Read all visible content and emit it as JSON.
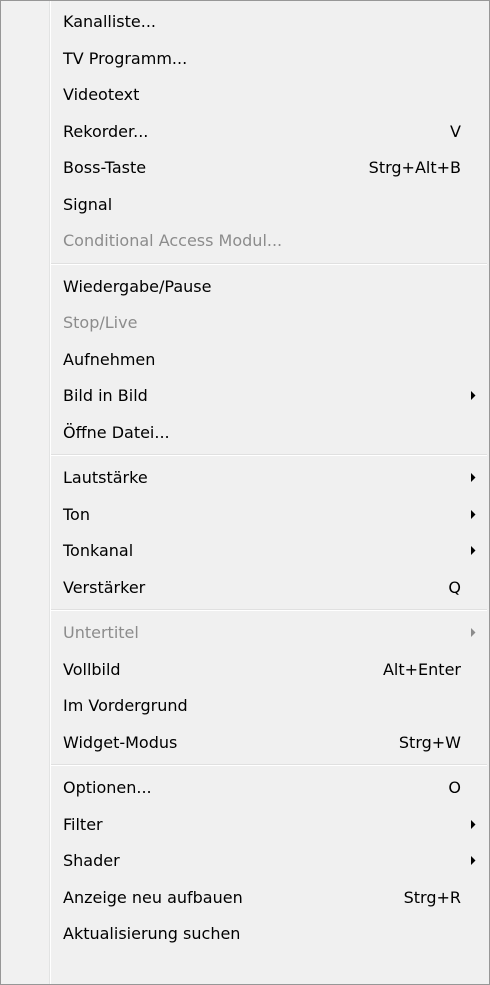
{
  "menu": {
    "groups": [
      {
        "items": [
          {
            "label": "Kanalliste..."
          },
          {
            "label": "TV Programm..."
          },
          {
            "label": "Videotext"
          },
          {
            "label": "Rekorder...",
            "shortcut": "V"
          },
          {
            "label": "Boss-Taste",
            "shortcut": "Strg+Alt+B"
          },
          {
            "label": "Signal"
          },
          {
            "label": "Conditional Access Modul...",
            "disabled": true
          }
        ]
      },
      {
        "items": [
          {
            "label": "Wiedergabe/Pause"
          },
          {
            "label": "Stop/Live",
            "disabled": true
          },
          {
            "label": "Aufnehmen"
          },
          {
            "label": "Bild in Bild",
            "submenu": true
          },
          {
            "label": "Öffne Datei..."
          }
        ]
      },
      {
        "items": [
          {
            "label": "Lautstärke",
            "submenu": true
          },
          {
            "label": "Ton",
            "submenu": true
          },
          {
            "label": "Tonkanal",
            "submenu": true
          },
          {
            "label": "Verstärker",
            "shortcut": "Q"
          }
        ]
      },
      {
        "items": [
          {
            "label": "Untertitel",
            "submenu": true,
            "disabled": true
          },
          {
            "label": "Vollbild",
            "shortcut": "Alt+Enter"
          },
          {
            "label": "Im Vordergrund"
          },
          {
            "label": "Widget-Modus",
            "shortcut": "Strg+W"
          }
        ]
      },
      {
        "items": [
          {
            "label": "Optionen...",
            "shortcut": "O"
          },
          {
            "label": "Filter",
            "submenu": true
          },
          {
            "label": "Shader",
            "submenu": true
          },
          {
            "label": "Anzeige neu aufbauen",
            "shortcut": "Strg+R"
          },
          {
            "label": "Aktualisierung suchen"
          }
        ]
      }
    ]
  },
  "colors": {
    "text": "#000000",
    "disabled_text": "#8c8c8c",
    "background": "#f0f0f0",
    "border": "#979797"
  }
}
